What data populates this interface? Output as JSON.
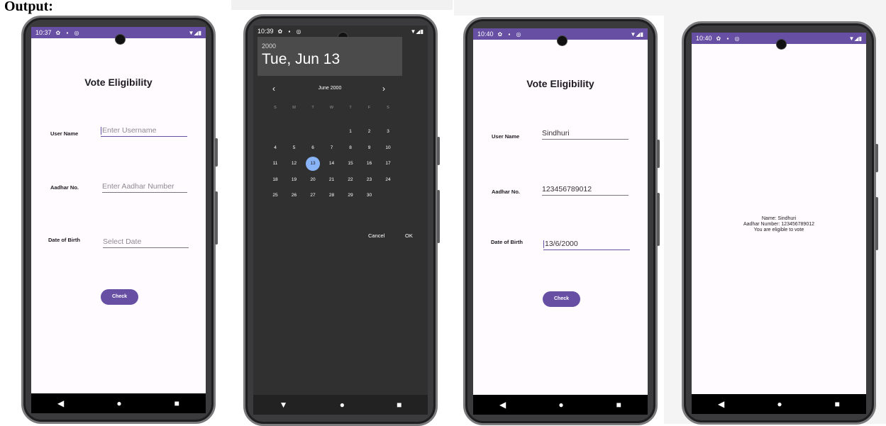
{
  "heading": "Output:",
  "colors": {
    "accent": "#6750a4",
    "selected_day": "#8ab4f8",
    "dialog_bg": "#303030"
  },
  "icons": {
    "status": "settings-sim-record-icons",
    "signal": "wifi-signal-battery-icons",
    "nav": [
      "back-icon",
      "home-icon",
      "recents-icon"
    ]
  },
  "screen1": {
    "time": "10:37",
    "title": "Vote Eligibility",
    "username_label": "User Name",
    "username_placeholder": "Enter Username",
    "aadhar_label": "Aadhar No.",
    "aadhar_placeholder": "Enter Aadhar Number",
    "dob_label": "Date of Birth",
    "dob_placeholder": "Select Date",
    "check_label": "Check"
  },
  "screen2": {
    "time": "10:39",
    "year": "2000",
    "date": "Tue, Jun 13",
    "month": "June 2000",
    "prev": "‹",
    "next": "›",
    "weekdays": [
      "S",
      "M",
      "T",
      "W",
      "T",
      "F",
      "S"
    ],
    "days": [
      "1",
      "2",
      "3",
      "4",
      "5",
      "6",
      "7",
      "8",
      "9",
      "10",
      "11",
      "12",
      "13",
      "14",
      "15",
      "16",
      "17",
      "18",
      "19",
      "20",
      "21",
      "22",
      "23",
      "24",
      "25",
      "26",
      "27",
      "28",
      "29",
      "30"
    ],
    "selected_day": "13",
    "cancel": "Cancel",
    "ok": "OK"
  },
  "screen3": {
    "time": "10:40",
    "title": "Vote Eligibility",
    "username_label": "User Name",
    "username_value": "Sindhuri",
    "aadhar_label": "Aadhar No.",
    "aadhar_value": "123456789012",
    "dob_label": "Date of Birth",
    "dob_value": "13/6/2000",
    "check_label": "Check"
  },
  "screen4": {
    "time": "10:40",
    "line1": "Name: Sindhuri",
    "line2": "Aadhar Number: 123456789012",
    "line3": "You are eligible to vote"
  }
}
